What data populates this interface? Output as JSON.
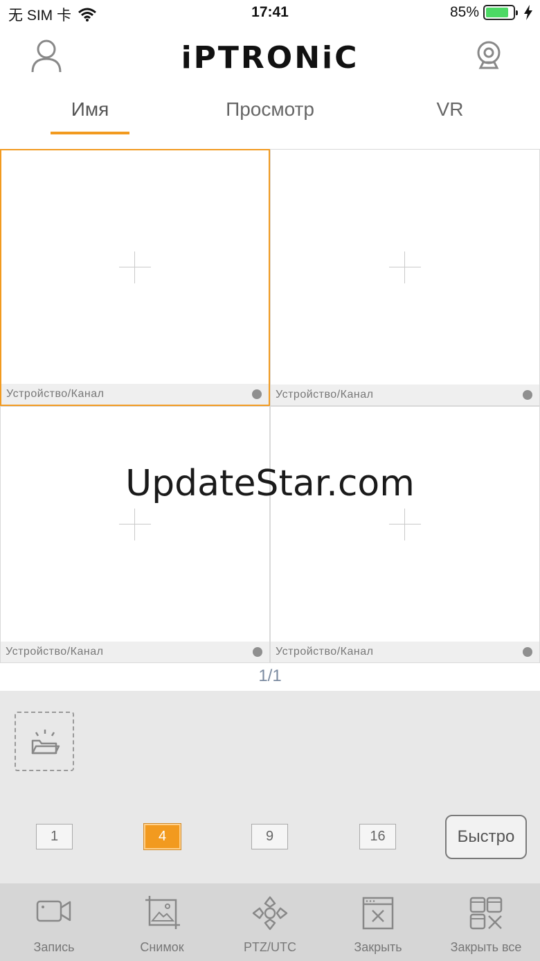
{
  "status_bar": {
    "carrier": "无 SIM 卡",
    "time": "17:41",
    "battery_percent": "85%",
    "battery_level": 0.85,
    "battery_color": "#4cd964"
  },
  "header": {
    "logo": "iPTRONiC",
    "user_icon": "user-icon",
    "camera_icon": "webcam-icon"
  },
  "tabs": [
    {
      "label": "Имя",
      "active": true
    },
    {
      "label": "Просмотр",
      "active": false
    },
    {
      "label": "VR",
      "active": false
    }
  ],
  "grid": {
    "cells": [
      {
        "label": "Устройство/Канал",
        "selected": true
      },
      {
        "label": "Устройство/Канал",
        "selected": false
      },
      {
        "label": "Устройство/Канал",
        "selected": false
      },
      {
        "label": "Устройство/Канал",
        "selected": false
      }
    ]
  },
  "watermark": "UpdateStar.com",
  "pager": "1/1",
  "layout_options": {
    "splits": [
      "1",
      "4",
      "9",
      "16"
    ],
    "selected_split": "4",
    "quick_label": "Быстро"
  },
  "toolbar": [
    {
      "label": "Запись",
      "icon": "video-camera-icon"
    },
    {
      "label": "Снимок",
      "icon": "snapshot-icon"
    },
    {
      "label": "PTZ/UTC",
      "icon": "ptz-icon"
    },
    {
      "label": "Закрыть",
      "icon": "close-window-icon"
    },
    {
      "label": "Закрыть все",
      "icon": "close-all-icon"
    }
  ],
  "colors": {
    "accent": "#f29a1f",
    "panel_bg": "#e8e8e8",
    "toolbar_bg": "#d6d6d6"
  }
}
